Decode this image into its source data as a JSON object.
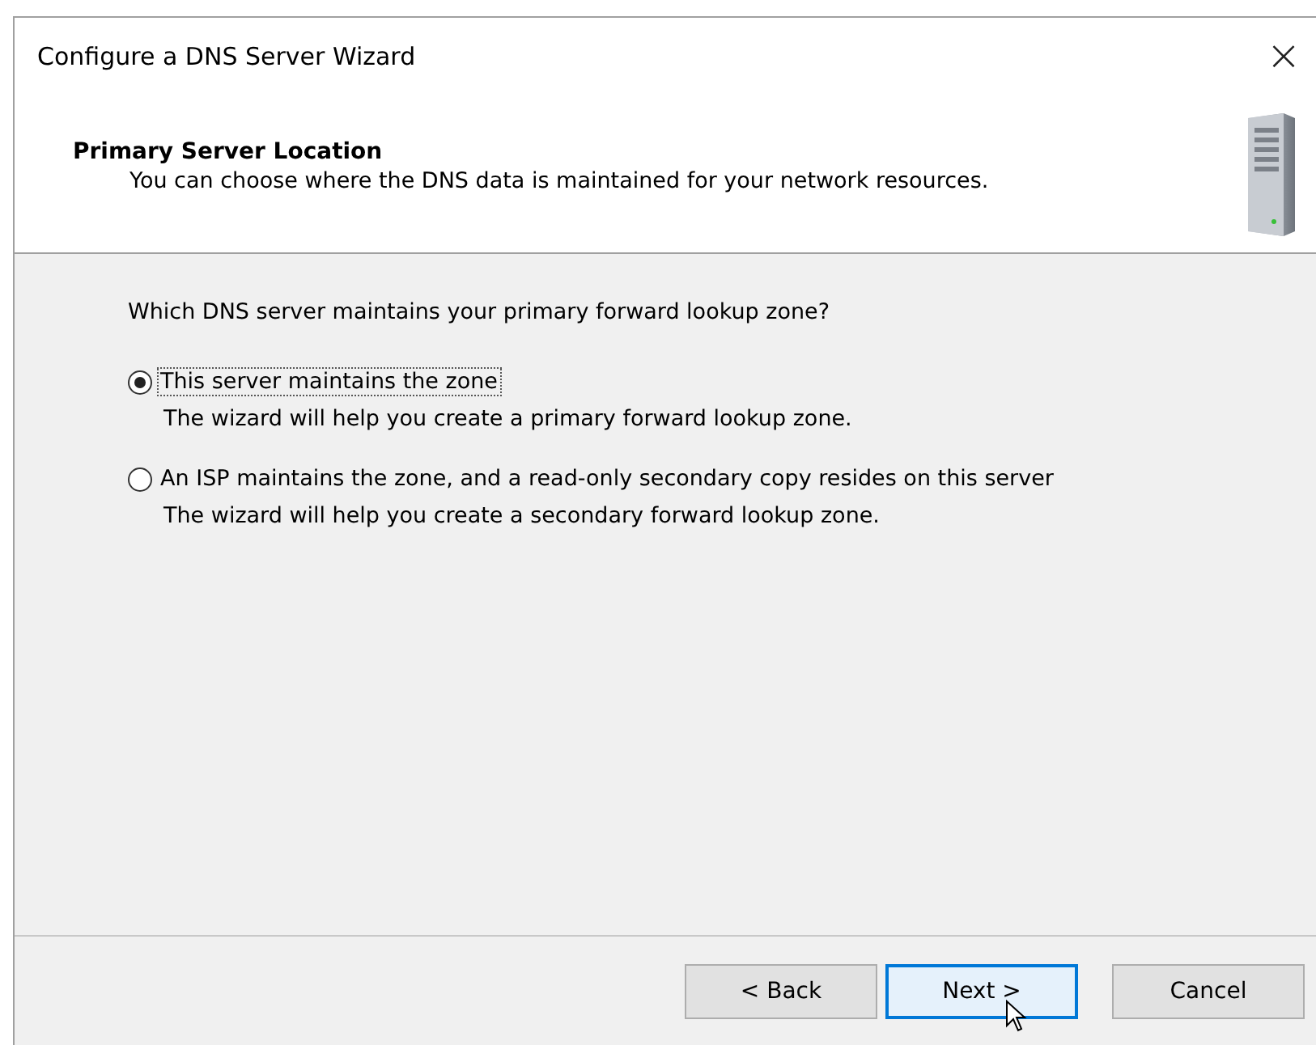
{
  "window": {
    "title": "Configure a DNS Server Wizard",
    "close": "×"
  },
  "header": {
    "title": "Primary Server Location",
    "subtitle": "You can choose where the DNS data is maintained for your network resources."
  },
  "question": "Which DNS server maintains your primary forward lookup zone?",
  "options": [
    {
      "label": "This server maintains the zone",
      "description": "The wizard will help you create a primary forward lookup zone.",
      "selected": true
    },
    {
      "label": "An ISP maintains the zone, and a read-only secondary copy resides on this server",
      "description": "The wizard will help you create a secondary forward lookup zone.",
      "selected": false
    }
  ],
  "buttons": [
    {
      "label": "< Back",
      "default": false
    },
    {
      "label": "Next >",
      "default": true
    },
    {
      "label": "Cancel",
      "default": false
    }
  ]
}
